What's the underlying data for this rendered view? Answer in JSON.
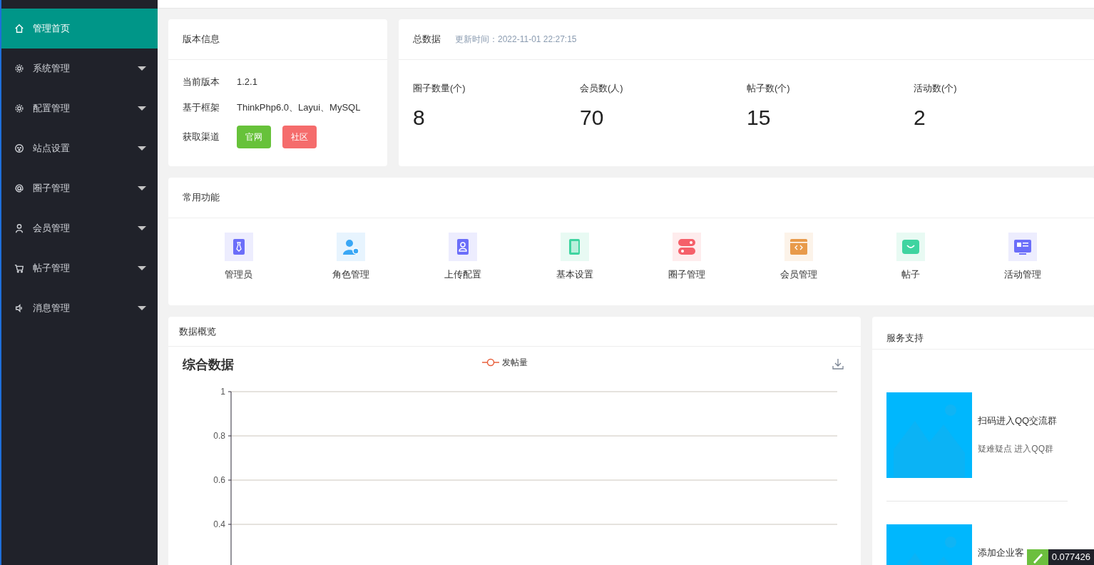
{
  "sidebar": {
    "items": [
      {
        "label": "管理首页",
        "selected": true,
        "kind": "link"
      },
      {
        "label": "系统管理",
        "selected": false,
        "kind": "menu"
      },
      {
        "label": "配置管理",
        "selected": false,
        "kind": "menu"
      },
      {
        "label": "站点设置",
        "selected": false,
        "kind": "menu"
      },
      {
        "label": "圈子管理",
        "selected": false,
        "kind": "menu"
      },
      {
        "label": "会员管理",
        "selected": false,
        "kind": "menu"
      },
      {
        "label": "帖子管理",
        "selected": false,
        "kind": "menu"
      },
      {
        "label": "消息管理",
        "selected": false,
        "kind": "menu"
      }
    ]
  },
  "version_card": {
    "title": "版本信息",
    "rows": [
      {
        "label": "当前版本",
        "kind": "text",
        "value": "1.2.1"
      },
      {
        "label": "基于框架",
        "kind": "text",
        "value": "ThinkPhp6.0、Layui、MySQL"
      },
      {
        "label": "获取渠道",
        "kind": "buttons",
        "buttons": [
          {
            "label": "官网",
            "color": "#67c23a"
          },
          {
            "label": "社区",
            "color": "#f56c6c"
          }
        ]
      }
    ]
  },
  "totals_card": {
    "title": "总数据",
    "updated": "更新时间：2022-11-01 22:27:15",
    "stats": [
      {
        "label": "圈子数量(个)",
        "value": "8"
      },
      {
        "label": "会员数(人)",
        "value": "70"
      },
      {
        "label": "帖子数(个)",
        "value": "15"
      },
      {
        "label": "活动数(个)",
        "value": "2"
      }
    ]
  },
  "shortcuts_card": {
    "title": "常用功能",
    "items": [
      {
        "label": "管理员"
      },
      {
        "label": "角色管理"
      },
      {
        "label": "上传配置"
      },
      {
        "label": "基本设置"
      },
      {
        "label": "圈子管理"
      },
      {
        "label": "会员管理"
      },
      {
        "label": "帖子"
      },
      {
        "label": "活动管理"
      }
    ]
  },
  "overview_card": {
    "title": "数据概览",
    "chart_data": {
      "type": "line",
      "title": "综合数据",
      "series": [
        {
          "name": "发帖量",
          "color": "#e8603c"
        }
      ],
      "ylim": [
        0,
        1
      ],
      "grid": true,
      "yticks": [
        0.4,
        0.6,
        0.8,
        1
      ]
    }
  },
  "support_card": {
    "title": "服务支持",
    "items": [
      {
        "title": "扫码进入QQ交流群",
        "subtitle": "疑难疑点 进入QQ群"
      },
      {
        "title": "添加企业客"
      }
    ]
  },
  "floating_widget": {
    "value": "0.077426"
  }
}
